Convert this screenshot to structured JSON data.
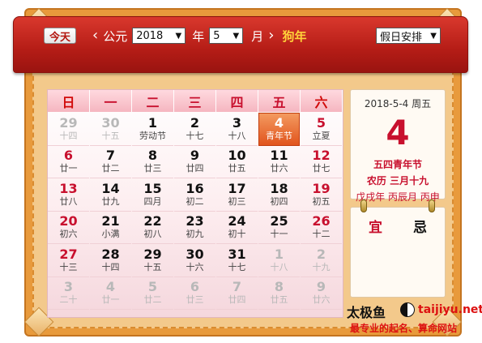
{
  "header": {
    "today_label": "今天",
    "prev_icon": "chevron-left-icon",
    "era_label": "公元",
    "year_value": "2018",
    "year_unit": "年",
    "month_value": "5",
    "month_unit": "月",
    "next_icon": "chevron-right-icon",
    "zodiac": "狗年",
    "holiday_select": "假日安排"
  },
  "weekdays": [
    "日",
    "一",
    "二",
    "三",
    "四",
    "五",
    "六"
  ],
  "days": [
    {
      "d": "29",
      "l": "十四",
      "other": true,
      "weekend": true
    },
    {
      "d": "30",
      "l": "十五",
      "other": true
    },
    {
      "d": "1",
      "l": "劳动节"
    },
    {
      "d": "2",
      "l": "十七"
    },
    {
      "d": "3",
      "l": "十八"
    },
    {
      "d": "4",
      "l": "青年节",
      "today": true
    },
    {
      "d": "5",
      "l": "立夏",
      "weekend": true
    },
    {
      "d": "6",
      "l": "廿一",
      "weekend": true
    },
    {
      "d": "7",
      "l": "廿二"
    },
    {
      "d": "8",
      "l": "廿三"
    },
    {
      "d": "9",
      "l": "廿四"
    },
    {
      "d": "10",
      "l": "廿五"
    },
    {
      "d": "11",
      "l": "廿六"
    },
    {
      "d": "12",
      "l": "廿七",
      "weekend": true
    },
    {
      "d": "13",
      "l": "廿八",
      "weekend": true
    },
    {
      "d": "14",
      "l": "廿九"
    },
    {
      "d": "15",
      "l": "四月"
    },
    {
      "d": "16",
      "l": "初二"
    },
    {
      "d": "17",
      "l": "初三"
    },
    {
      "d": "18",
      "l": "初四"
    },
    {
      "d": "19",
      "l": "初五",
      "weekend": true
    },
    {
      "d": "20",
      "l": "初六",
      "weekend": true
    },
    {
      "d": "21",
      "l": "小满"
    },
    {
      "d": "22",
      "l": "初八"
    },
    {
      "d": "23",
      "l": "初九"
    },
    {
      "d": "24",
      "l": "初十"
    },
    {
      "d": "25",
      "l": "十一"
    },
    {
      "d": "26",
      "l": "十二",
      "weekend": true
    },
    {
      "d": "27",
      "l": "十三",
      "weekend": true
    },
    {
      "d": "28",
      "l": "十四"
    },
    {
      "d": "29",
      "l": "十五"
    },
    {
      "d": "30",
      "l": "十六"
    },
    {
      "d": "31",
      "l": "十七"
    },
    {
      "d": "1",
      "l": "十八",
      "other": true
    },
    {
      "d": "2",
      "l": "十九",
      "other": true
    },
    {
      "d": "3",
      "l": "二十",
      "other": true
    },
    {
      "d": "4",
      "l": "廿一",
      "other": true
    },
    {
      "d": "5",
      "l": "廿二",
      "other": true
    },
    {
      "d": "6",
      "l": "廿三",
      "other": true
    },
    {
      "d": "7",
      "l": "廿四",
      "other": true
    },
    {
      "d": "8",
      "l": "廿五",
      "other": true
    },
    {
      "d": "9",
      "l": "廿六",
      "other": true
    }
  ],
  "side": {
    "date_line": "2018-5-4 周五",
    "big_day": "4",
    "festival": "五四青年节",
    "lunar": "农历 三月十九",
    "ganzhi": "戊戌年 丙辰月 丙申"
  },
  "yiji": {
    "yi": "宜",
    "ji": "忌"
  },
  "watermark": {
    "title": "太极鱼",
    "url": "taijiyu.net",
    "slogan": "最专业的起名、算命网站"
  },
  "colors": {
    "header_red": "#b41c16",
    "accent_red": "#c8102e",
    "today_orange": "#e1541d",
    "frame_orange": "#e89a3c"
  }
}
